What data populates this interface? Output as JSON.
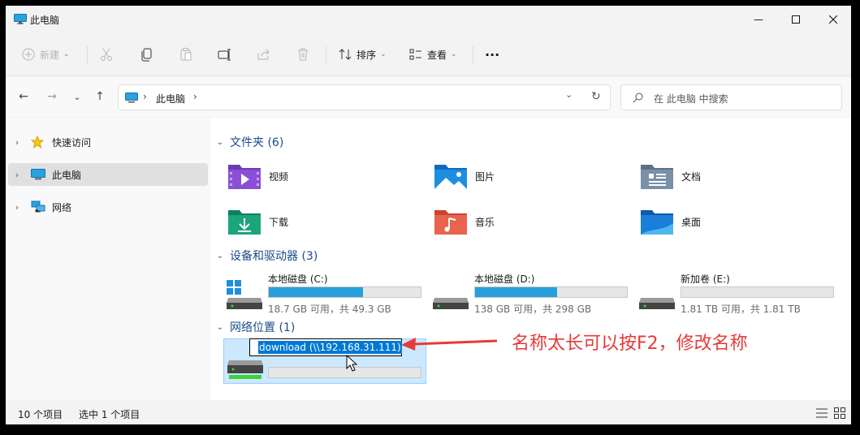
{
  "window": {
    "title": "此电脑",
    "minimize_glyph": "—",
    "maximize_glyph": "☐",
    "close_glyph": "✕"
  },
  "toolbar": {
    "new_label": "新建",
    "sort_label": "排序",
    "view_label": "查看",
    "more_label": "···",
    "icons": [
      "plus-circle-icon",
      "cut-icon",
      "copy-icon",
      "paste-icon",
      "rename-icon",
      "share-icon",
      "delete-icon"
    ]
  },
  "nav": {
    "back": "←",
    "forward": "→",
    "recent": "⌄",
    "up": "↑",
    "breadcrumb_sep": "›",
    "location": "此电脑",
    "refresh": "↻",
    "search_placeholder": "在 此电脑 中搜索"
  },
  "sidebar": {
    "items": [
      {
        "label": "快速访问",
        "icon": "star-icon"
      },
      {
        "label": "此电脑",
        "icon": "computer-icon",
        "selected": true
      },
      {
        "label": "网络",
        "icon": "network-icon"
      }
    ]
  },
  "groups": {
    "folders_title": "文件夹 (6)",
    "drives_title": "设备和驱动器 (3)",
    "network_title": "网络位置 (1)"
  },
  "folders": [
    {
      "name": "视频",
      "icon": "videos-folder-icon",
      "color": "#8a4fd6"
    },
    {
      "name": "图片",
      "icon": "pictures-folder-icon",
      "color": "#1e8fe0"
    },
    {
      "name": "文档",
      "icon": "documents-folder-icon",
      "color": "#7a8fa8"
    },
    {
      "name": "下载",
      "icon": "downloads-folder-icon",
      "color": "#1aa57a"
    },
    {
      "name": "音乐",
      "icon": "music-folder-icon",
      "color": "#e8644f"
    },
    {
      "name": "桌面",
      "icon": "desktop-folder-icon",
      "color": "#1a7fd8"
    }
  ],
  "drives": [
    {
      "name": "本地磁盘 (C:)",
      "usage": "18.7 GB 可用，共 49.3 GB",
      "used_fraction": 0.62
    },
    {
      "name": "本地磁盘 (D:)",
      "usage": "138 GB 可用，共 298 GB",
      "used_fraction": 0.54
    },
    {
      "name": "新加卷 (E:)",
      "usage": "1.81 TB 可用，共 1.81 TB",
      "used_fraction": 0.0
    }
  ],
  "network_location": {
    "rename_value": "download (\\\\192.168.31.111)"
  },
  "annotation": "名称太长可以按F2，修改名称",
  "status": {
    "count": "10 个项目",
    "selected": "选中 1 个项目"
  },
  "colors": {
    "accent": "#0078d7",
    "drive_bar": "#26a0da",
    "annotation": "#e63a3a",
    "group_title": "#1b4a8c"
  }
}
